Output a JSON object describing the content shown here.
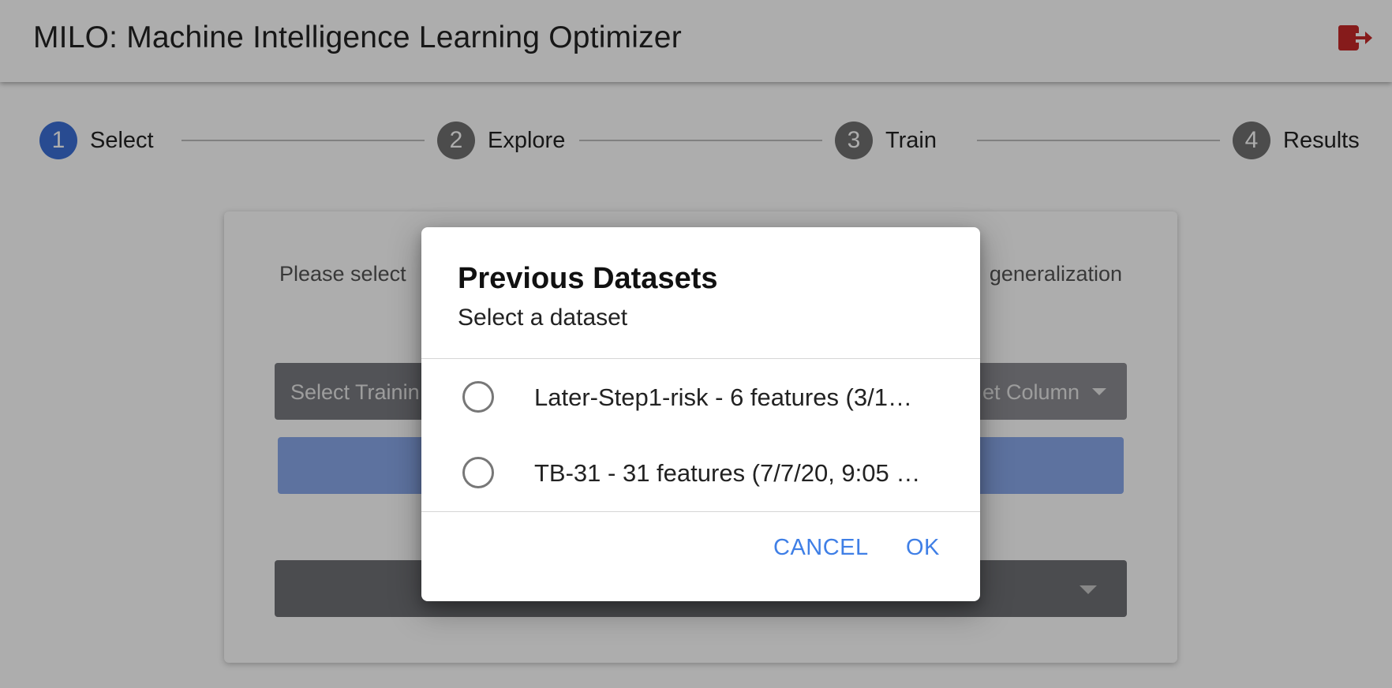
{
  "header": {
    "title": "MILO: Machine Intelligence Learning Optimizer",
    "logout_icon": "logout-icon",
    "logout_color": "#c62828"
  },
  "stepper": {
    "active_color": "#3b6fd6",
    "inactive_color": "#707070",
    "steps": [
      {
        "number": "1",
        "label": "Select",
        "active": true
      },
      {
        "number": "2",
        "label": "Explore",
        "active": false
      },
      {
        "number": "3",
        "label": "Train",
        "active": false
      },
      {
        "number": "4",
        "label": "Results",
        "active": false
      }
    ]
  },
  "card": {
    "intro_left": "Please select",
    "intro_right": "generalization",
    "training_select_placeholder": "Select Trainin",
    "target_select_placeholder": "et Column"
  },
  "dialog": {
    "title": "Previous Datasets",
    "subtitle": "Select a dataset",
    "options": [
      {
        "label": "Later-Step1-risk - 6 features (3/1…",
        "selected": false
      },
      {
        "label": "TB-31 - 31 features (7/7/20, 9:05 …",
        "selected": false
      }
    ],
    "cancel_label": "CANCEL",
    "ok_label": "OK",
    "accent": "#3f7fe6"
  }
}
